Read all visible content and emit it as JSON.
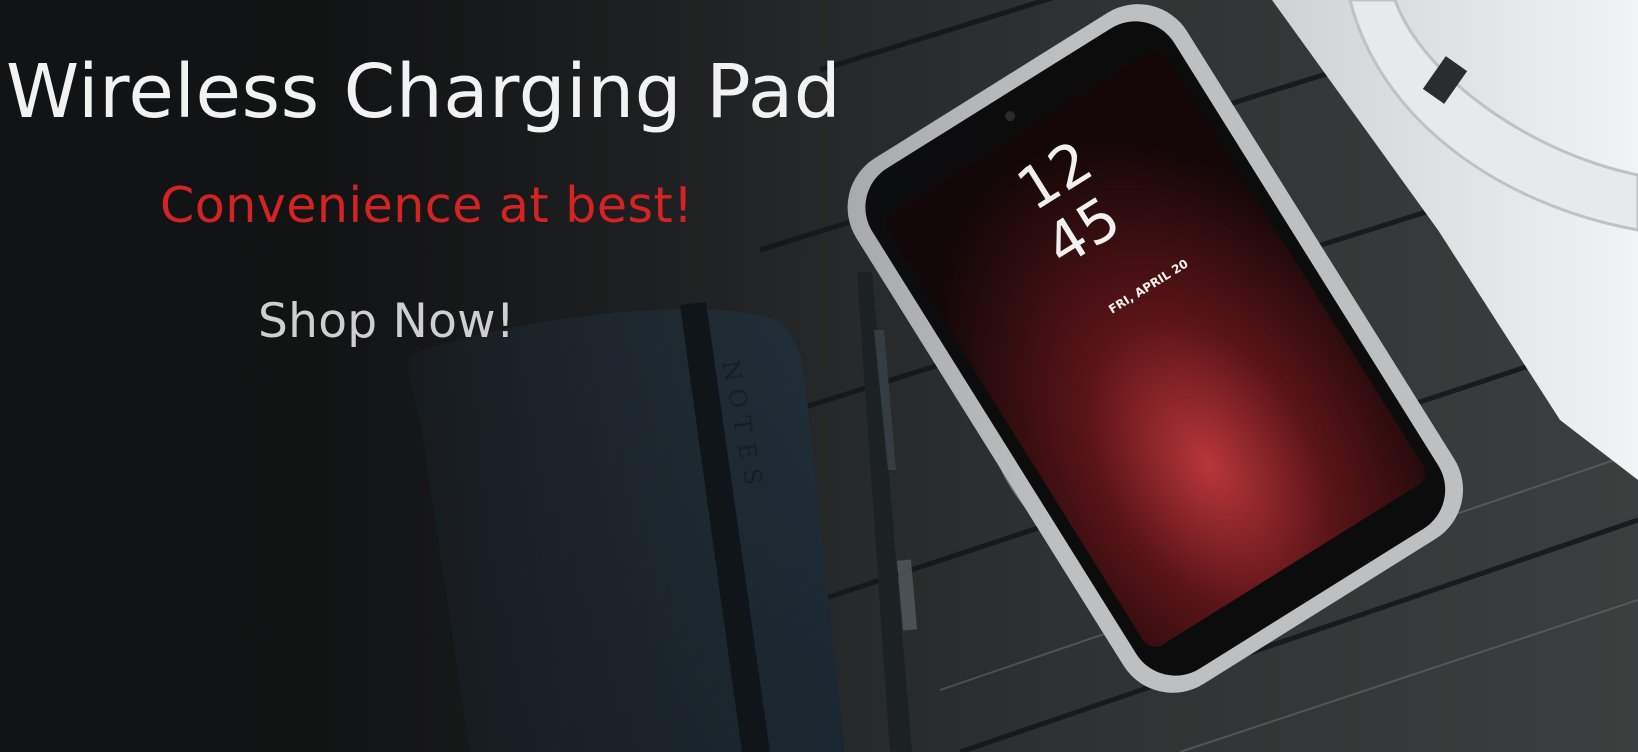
{
  "hero": {
    "headline": "Wireless Charging Pad",
    "tagline": "Convenience at best!",
    "cta_label": "Shop Now!"
  },
  "phone": {
    "clock_hour": "12",
    "clock_minute": "45",
    "date": "FRI, APRIL 20"
  },
  "notebook": {
    "spine_text": "NOTES"
  },
  "colors": {
    "headline": "#f2f2f2",
    "tagline": "#d42323",
    "cta": "#cfcfcf"
  }
}
